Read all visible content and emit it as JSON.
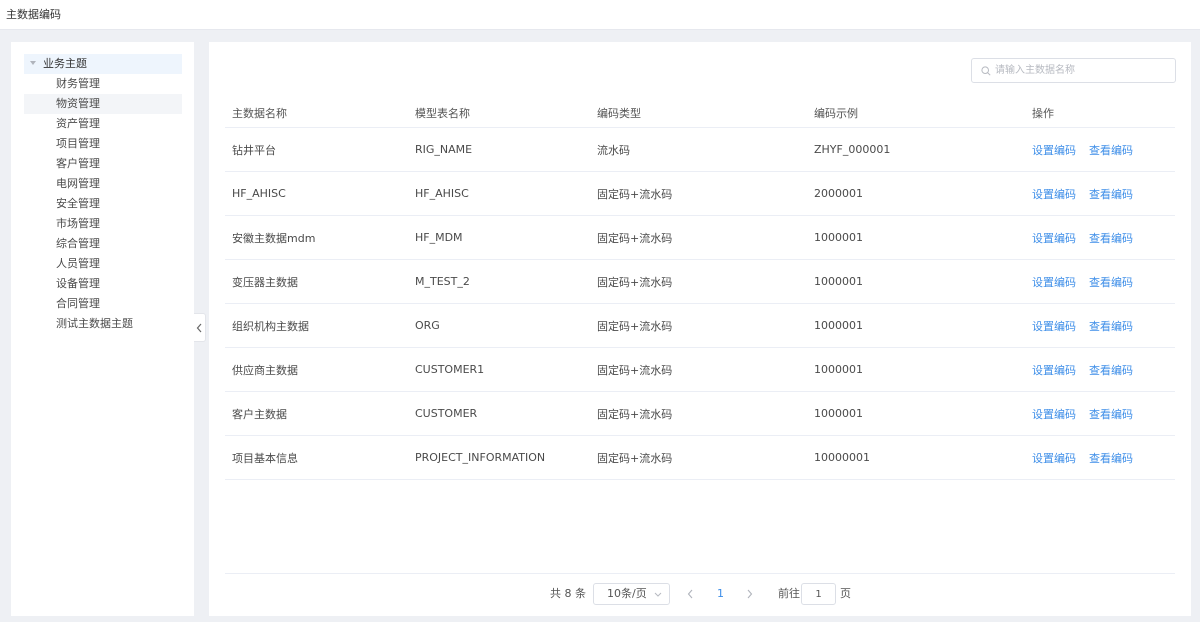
{
  "header": {
    "title": "主数据编码"
  },
  "sidebar": {
    "root": "业务主题",
    "items": [
      "财务管理",
      "物资管理",
      "资产管理",
      "项目管理",
      "客户管理",
      "电网管理",
      "安全管理",
      "市场管理",
      "综合管理",
      "人员管理",
      "设备管理",
      "合同管理",
      "测试主数据主题"
    ]
  },
  "search": {
    "placeholder": "请输入主数据名称",
    "value": ""
  },
  "table": {
    "columns": [
      "主数据名称",
      "模型表名称",
      "编码类型",
      "编码示例",
      "操作"
    ],
    "rows": [
      {
        "name": "钻井平台",
        "model": "RIG_NAME",
        "type": "流水码",
        "example": "ZHYF_000001"
      },
      {
        "name": "HF_AHISC",
        "model": "HF_AHISC",
        "type": "固定码+流水码",
        "example": "2000001"
      },
      {
        "name": "安徽主数据mdm",
        "model": "HF_MDM",
        "type": "固定码+流水码",
        "example": "1000001"
      },
      {
        "name": "变压器主数据",
        "model": "M_TEST_2",
        "type": "固定码+流水码",
        "example": "1000001"
      },
      {
        "name": "组织机构主数据",
        "model": "ORG",
        "type": "固定码+流水码",
        "example": "1000001"
      },
      {
        "name": "供应商主数据",
        "model": "CUSTOMER1",
        "type": "固定码+流水码",
        "example": "1000001"
      },
      {
        "name": "客户主数据",
        "model": "CUSTOMER",
        "type": "固定码+流水码",
        "example": "1000001"
      },
      {
        "name": "项目基本信息",
        "model": "PROJECT_INFORMATION",
        "type": "固定码+流水码",
        "example": "10000001"
      }
    ],
    "actions": {
      "set": "设置编码",
      "view": "查看编码"
    }
  },
  "pagination": {
    "total": "共 8 条",
    "page_size": "10条/页",
    "current_page": "1",
    "goto_label": "前往",
    "goto_value": "1",
    "page_unit": "页"
  },
  "colors": {
    "accent": "#3d8ee8",
    "selected_bg": "#eef5fd"
  }
}
